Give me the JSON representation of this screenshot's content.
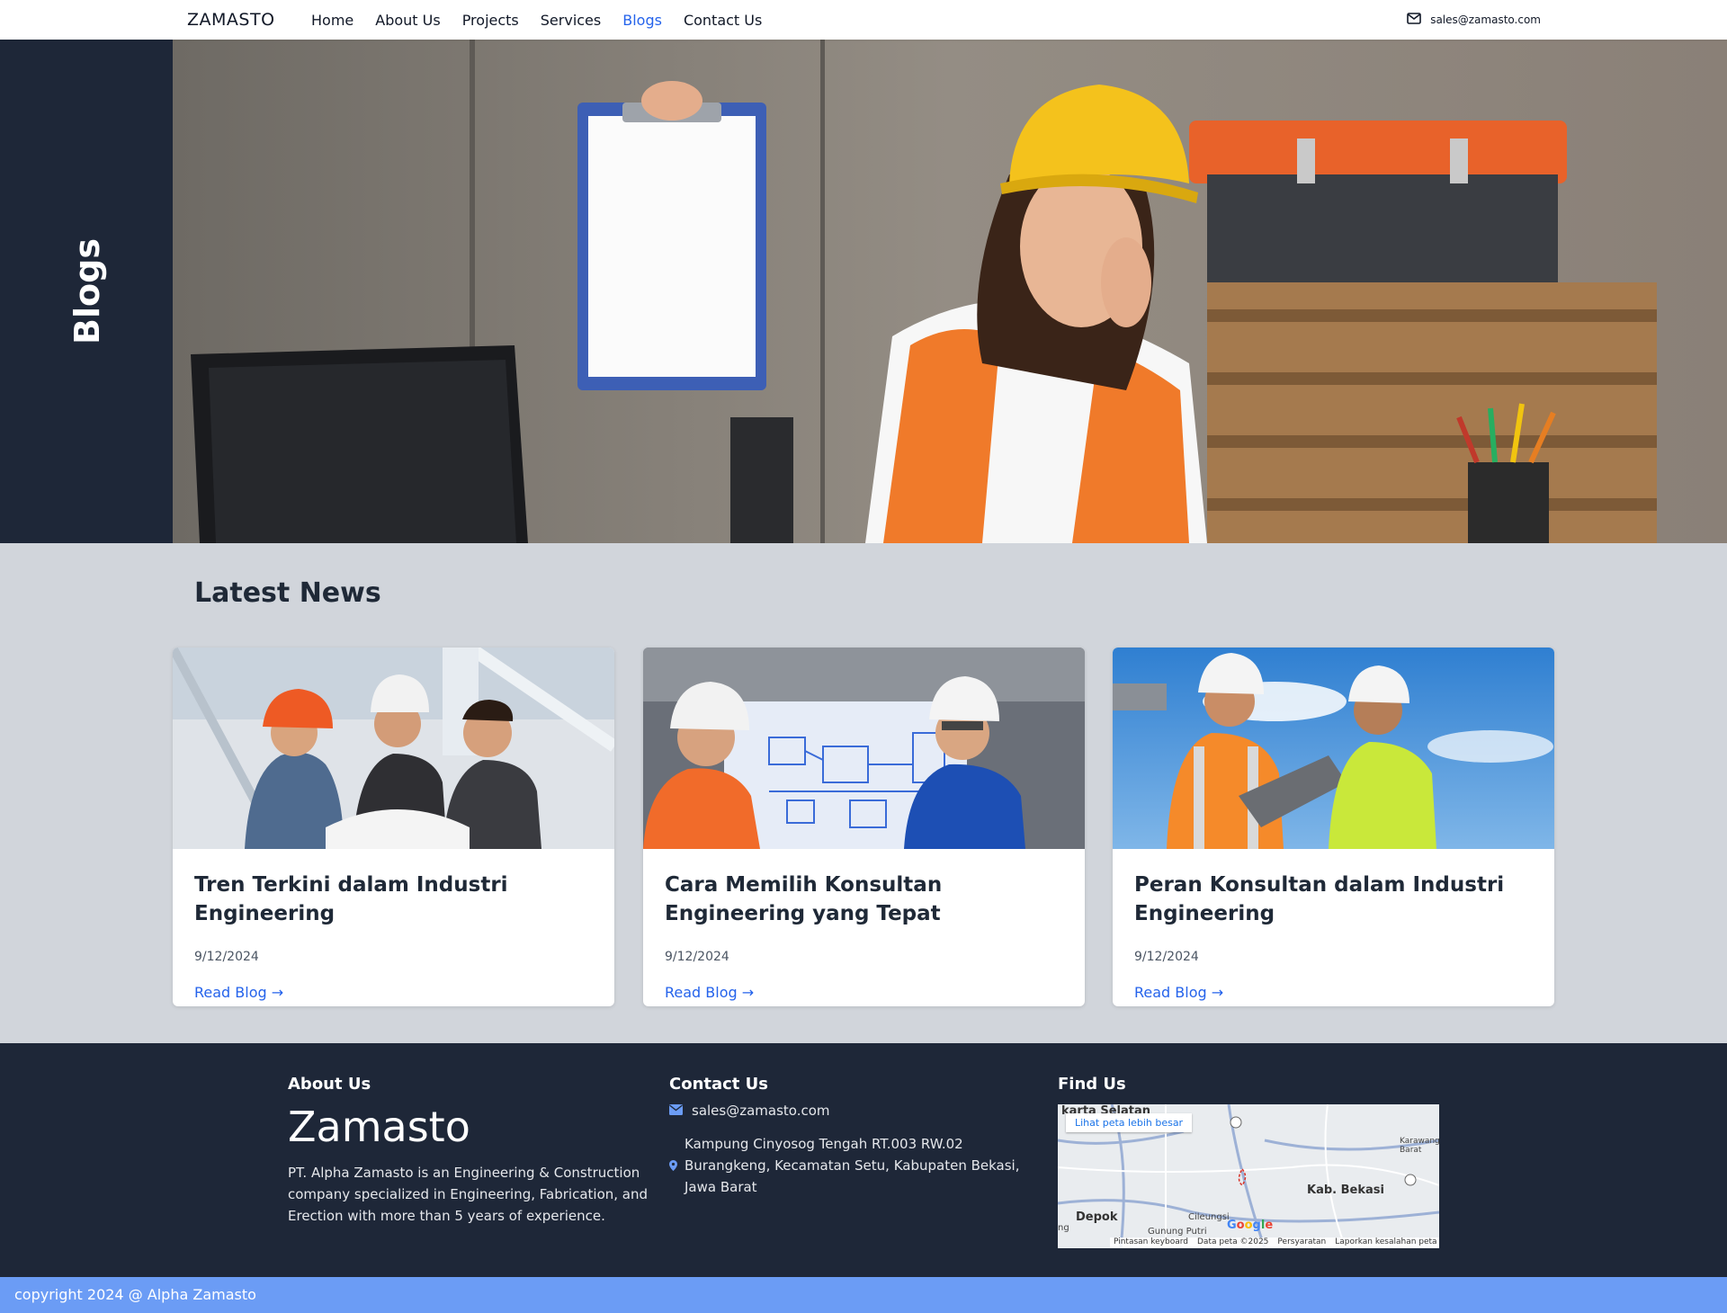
{
  "nav": {
    "brand": "ZAMASTO",
    "items": [
      "Home",
      "About Us",
      "Projects",
      "Services",
      "Blogs",
      "Contact Us"
    ],
    "active": "Blogs",
    "email": "sales@zamasto.com"
  },
  "hero": {
    "title": "Blogs"
  },
  "news": {
    "title": "Latest News",
    "cards": [
      {
        "title": "Tren Terkini dalam Industri Engineering",
        "date": "9/12/2024",
        "link": "Read Blog →"
      },
      {
        "title": "Cara Memilih Konsultan Engineering yang Tepat",
        "date": "9/12/2024",
        "link": "Read Blog →"
      },
      {
        "title": "Peran Konsultan dalam Industri Engineering",
        "date": "9/12/2024",
        "link": "Read Blog →"
      }
    ]
  },
  "footer": {
    "about_heading": "About Us",
    "brand": "Zamasto",
    "description": "PT. Alpha Zamasto is an Engineering & Construction company specialized in Engineering, Fabrication, and Erection with more than 5 years of experience.",
    "contact_heading": "Contact Us",
    "email": "sales@zamasto.com",
    "address": "Kampung Cinyosog Tengah RT.003 RW.02 Burangkeng, Kecamatan Setu, Kabupaten Bekasi, Jawa Barat",
    "find_heading": "Find Us",
    "map": {
      "button": "Lihat peta lebih besar",
      "labels": [
        "karta Selatan",
        "Kab. Bekasi",
        "Depok",
        "Cileungsi",
        "Gunung Putri",
        "Karawang Barat",
        "ng"
      ],
      "google": "Google",
      "footer_links": [
        "Pintasan keyboard",
        "Data peta ©2025",
        "Persyaratan",
        "Laporkan kesalahan peta"
      ]
    }
  },
  "copyright": "copyright 2024 @ Alpha Zamasto",
  "colors": {
    "nav_active": "#2563eb",
    "dark": "#1e2738",
    "copyright_bar": "#6b9cf5"
  }
}
